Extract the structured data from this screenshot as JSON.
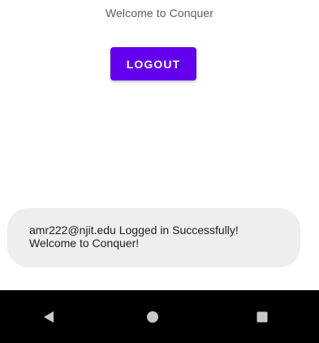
{
  "main": {
    "welcome_text": "Welcome to Conquer",
    "logout_label": "LOGOUT"
  },
  "toast": {
    "line1": "amr222@njit.edu Logged in Successfully!",
    "line2": "Welcome to Conquer!"
  },
  "navbar": {
    "back_icon": "back-triangle-icon",
    "home_icon": "home-circle-icon",
    "recents_icon": "recents-square-icon"
  },
  "colors": {
    "accent": "#6200ee",
    "toast_bg": "#eeeeee",
    "navbar_bg": "#000000",
    "nav_icon": "#c8c8c8"
  }
}
